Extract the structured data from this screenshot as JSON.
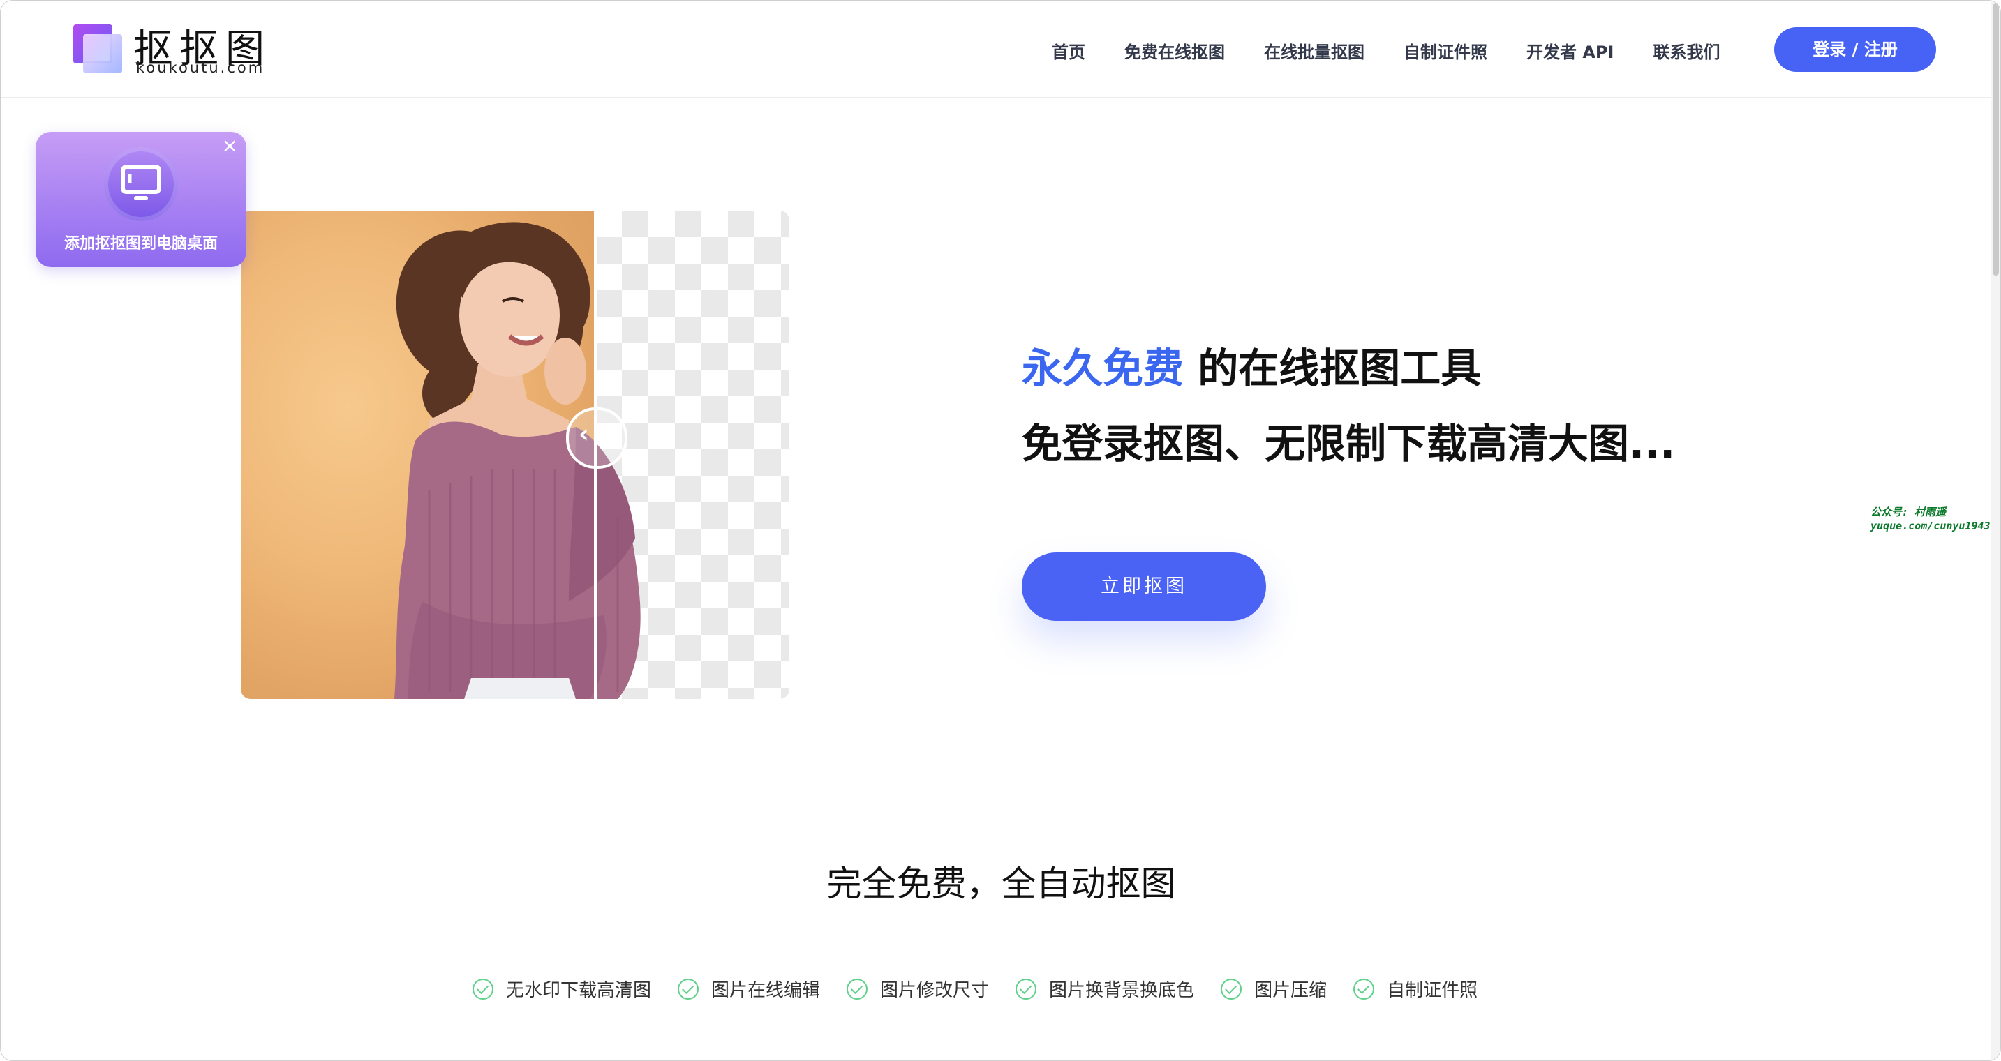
{
  "brand": {
    "name_cn": "抠抠图",
    "domain": "koukoutu.com"
  },
  "nav": {
    "items": [
      {
        "label": "首页"
      },
      {
        "label": "免费在线抠图"
      },
      {
        "label": "在线批量抠图"
      },
      {
        "label": "自制证件照"
      },
      {
        "label": "开发者 API"
      },
      {
        "label": "联系我们"
      }
    ],
    "login_label": "登录 / 注册"
  },
  "badge": {
    "text": "添加抠抠图到电脑桌面",
    "close_glyph": "×",
    "icon": "monitor-icon"
  },
  "hero": {
    "headline_accent": "永久免费",
    "headline_rest": " 的在线抠图工具",
    "subline": "免登录抠图、无限制下载高清大图...",
    "cta_label": "立即抠图",
    "handle_left": "‹",
    "handle_right": "›"
  },
  "watermark": {
    "line1": "公众号: 村雨遥",
    "line2": "yuque.com/cunyu1943"
  },
  "section": {
    "title": "完全免费，全自动抠图",
    "features": [
      {
        "label": "无水印下载高清图"
      },
      {
        "label": "图片在线编辑"
      },
      {
        "label": "图片修改尺寸"
      },
      {
        "label": "图片换背景换底色"
      },
      {
        "label": "图片压缩"
      },
      {
        "label": "自制证件照"
      }
    ]
  },
  "colors": {
    "primary": "#4763f5",
    "accent_text": "#3a66f0",
    "check": "#5fd18a",
    "badge_top": "#c69df5",
    "badge_bottom": "#8e6af0"
  }
}
